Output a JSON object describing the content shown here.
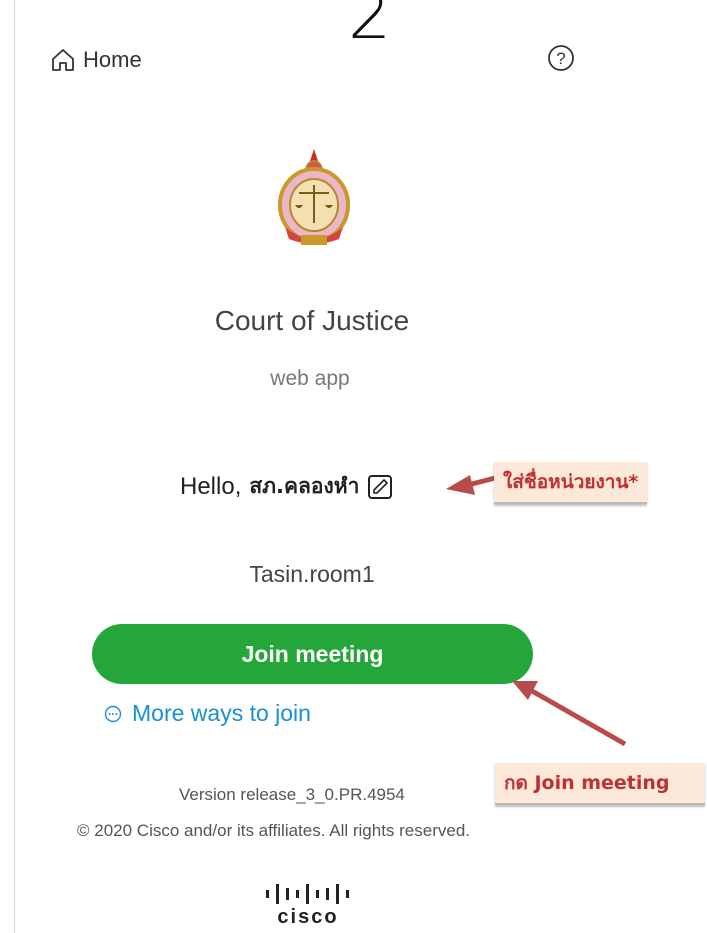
{
  "step": {
    "number": "2"
  },
  "header": {
    "home_label": "Home",
    "help_icon": "question-circle-icon"
  },
  "organization": {
    "name": "Court of Justice",
    "app_type": "web app"
  },
  "greeting": {
    "prefix": "Hello,",
    "user_name": "สภ.คลองหํา",
    "edit_icon": "pencil-square-icon"
  },
  "meeting": {
    "room": "Tasin.room1",
    "join_label": "Join meeting",
    "more_ways_label": "More ways to join",
    "more_ways_icon": "circle-ellipsis-icon"
  },
  "footer": {
    "version": "Version release_3_0.PR.4954",
    "copyright": "© 2020 Cisco and/or its affiliates. All rights reserved.",
    "logo_text": "cisco"
  },
  "annotations": {
    "name_hint": "ใส่ชื่อหน่วยงาน*",
    "join_hint": "กด Join meeting"
  },
  "colors": {
    "join_button": "#25a63a",
    "link": "#1a8fd4",
    "callout_bg": "#fde9d9",
    "callout_text": "#c03030",
    "arrow": "#b84c4c"
  }
}
